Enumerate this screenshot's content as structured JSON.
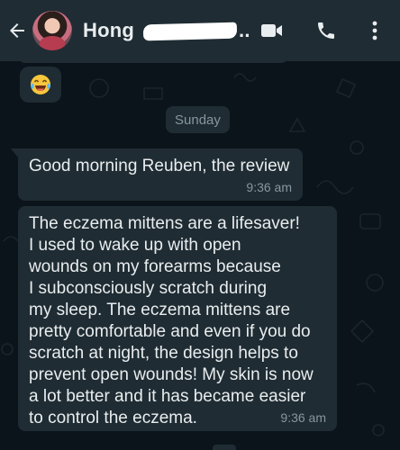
{
  "header": {
    "contact_name": "Hong",
    "name_suffix": "..",
    "icons": {
      "back": "arrow-back-icon",
      "video": "video-call-icon",
      "call": "phone-icon",
      "menu": "more-vertical-icon"
    }
  },
  "chat": {
    "reaction_emoji": "😂",
    "date_separator": "Sunday",
    "messages": [
      {
        "text": "Good morning Reuben, the review",
        "time": "9:36 am"
      },
      {
        "text": "The eczema mittens are a lifesaver!\nI used to wake up with open\nwounds on my forearms because\nI subconsciously scratch during\nmy sleep. The eczema mittens are\npretty comfortable and even if you do\nscratch at night, the design helps to\nprevent open wounds! My skin is now\na lot better and it has became easier\nto control the eczema.",
        "time": "9:36 am"
      }
    ]
  },
  "colors": {
    "header_bg": "#1f2c33",
    "chat_bg": "#0b141a",
    "bubble_bg": "#1f2c33",
    "text_primary": "#e9edef",
    "text_secondary": "#8696a0"
  }
}
